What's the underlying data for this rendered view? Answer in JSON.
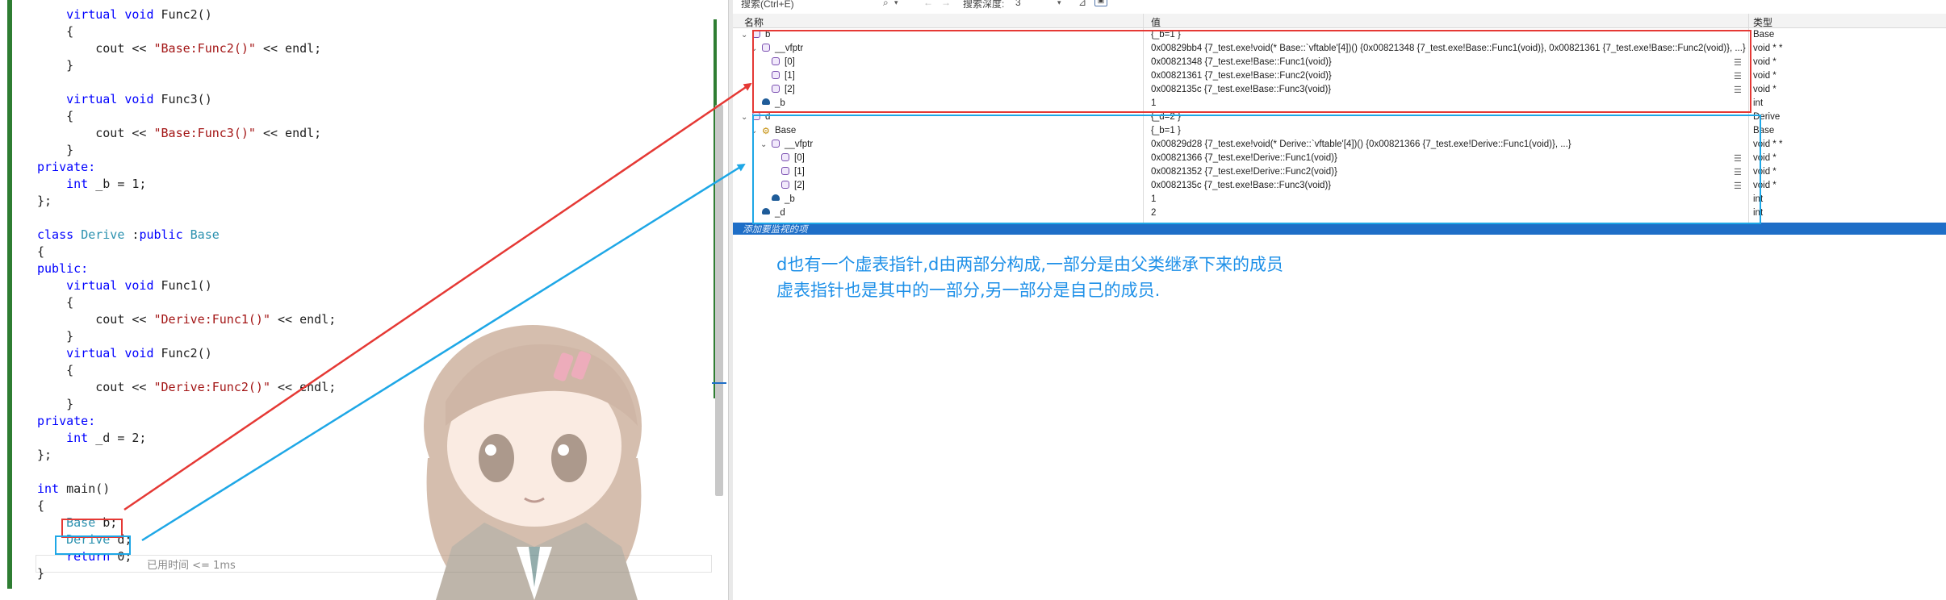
{
  "editor": {
    "lines": [
      [
        {
          "t": "    "
        },
        {
          "t": "virtual void",
          "c": "kw"
        },
        {
          "t": " Func2()"
        }
      ],
      [
        {
          "t": "    {"
        }
      ],
      [
        {
          "t": "        cout << "
        },
        {
          "t": "\"Base:Func2()\"",
          "c": "st"
        },
        {
          "t": " << endl;"
        }
      ],
      [
        {
          "t": "    }"
        }
      ],
      [
        {
          "t": ""
        }
      ],
      [
        {
          "t": "    "
        },
        {
          "t": "virtual void",
          "c": "kw"
        },
        {
          "t": " Func3()"
        }
      ],
      [
        {
          "t": "    {"
        }
      ],
      [
        {
          "t": "        cout << "
        },
        {
          "t": "\"Base:Func3()\"",
          "c": "st"
        },
        {
          "t": " << endl;"
        }
      ],
      [
        {
          "t": "    }"
        }
      ],
      [
        {
          "t": "private:",
          "c": "kw"
        }
      ],
      [
        {
          "t": "    "
        },
        {
          "t": "int",
          "c": "kw"
        },
        {
          "t": " _b = 1;"
        }
      ],
      [
        {
          "t": "};"
        }
      ],
      [
        {
          "t": ""
        }
      ],
      [
        {
          "t": "class",
          "c": "kw"
        },
        {
          "t": " "
        },
        {
          "t": "Derive",
          "c": "ty"
        },
        {
          "t": " :"
        },
        {
          "t": "public",
          "c": "kw"
        },
        {
          "t": " "
        },
        {
          "t": "Base",
          "c": "ty"
        }
      ],
      [
        {
          "t": "{"
        }
      ],
      [
        {
          "t": "public:",
          "c": "kw"
        }
      ],
      [
        {
          "t": "    "
        },
        {
          "t": "virtual void",
          "c": "kw"
        },
        {
          "t": " Func1()"
        }
      ],
      [
        {
          "t": "    {"
        }
      ],
      [
        {
          "t": "        cout << "
        },
        {
          "t": "\"Derive:Func1()\"",
          "c": "st"
        },
        {
          "t": " << endl;"
        }
      ],
      [
        {
          "t": "    }"
        }
      ],
      [
        {
          "t": "    "
        },
        {
          "t": "virtual void",
          "c": "kw"
        },
        {
          "t": " Func2()"
        }
      ],
      [
        {
          "t": "    {"
        }
      ],
      [
        {
          "t": "        cout << "
        },
        {
          "t": "\"Derive:Func2()\"",
          "c": "st"
        },
        {
          "t": " << endl;"
        }
      ],
      [
        {
          "t": "    }"
        }
      ],
      [
        {
          "t": "private:",
          "c": "kw"
        }
      ],
      [
        {
          "t": "    "
        },
        {
          "t": "int",
          "c": "kw"
        },
        {
          "t": " _d = 2;"
        }
      ],
      [
        {
          "t": "};"
        }
      ],
      [
        {
          "t": ""
        }
      ],
      [
        {
          "t": "int",
          "c": "kw"
        },
        {
          "t": " main()"
        }
      ],
      [
        {
          "t": "{"
        }
      ],
      [
        {
          "t": "    "
        },
        {
          "t": "Base",
          "c": "ty"
        },
        {
          "t": " b;"
        }
      ],
      [
        {
          "t": "    "
        },
        {
          "t": "Derive",
          "c": "ty"
        },
        {
          "t": " d;"
        }
      ],
      [
        {
          "t": "    "
        },
        {
          "t": "return",
          "c": "kw"
        },
        {
          "t": " 0;"
        }
      ],
      [
        {
          "t": "}"
        }
      ]
    ],
    "elapsed_hint": "已用时间 <= 1ms"
  },
  "watch": {
    "toolbar": {
      "search_placeholder": "搜索(Ctrl+E)",
      "depth_label": "搜索深度:",
      "depth_value": "3"
    },
    "columns": {
      "name": "名称",
      "value": "值",
      "type": "类型"
    },
    "rows": [
      {
        "chevron": "⌄",
        "icon": "obj",
        "indent": 0,
        "name": "b",
        "value": "{_b=1 }",
        "type": "Base"
      },
      {
        "chevron": "⌄",
        "icon": "obj",
        "indent": 1,
        "name": "__vfptr",
        "value": "0x00829bb4 {7_test.exe!void(* Base::`vftable'[4])() {0x00821348 {7_test.exe!Base::Func1(void)}, 0x00821361 {7_test.exe!Base::Func2(void)}, ...}",
        "type": "void * *"
      },
      {
        "chevron": "",
        "icon": "obj",
        "indent": 2,
        "name": "[0]",
        "value": "0x00821348 {7_test.exe!Base::Func1(void)}",
        "type": "void *",
        "view": true
      },
      {
        "chevron": "",
        "icon": "obj",
        "indent": 2,
        "name": "[1]",
        "value": "0x00821361 {7_test.exe!Base::Func2(void)}",
        "type": "void *",
        "view": true
      },
      {
        "chevron": "",
        "icon": "obj",
        "indent": 2,
        "name": "[2]",
        "value": "0x0082135c {7_test.exe!Base::Func3(void)}",
        "type": "void *",
        "view": true
      },
      {
        "chevron": "",
        "icon": "fld",
        "indent": 1,
        "name": "_b",
        "value": "1",
        "type": "int"
      },
      {
        "chevron": "⌄",
        "icon": "obj",
        "indent": 0,
        "name": "d",
        "value": "{_d=2 }",
        "type": "Derive"
      },
      {
        "chevron": "⌄",
        "icon": "base",
        "indent": 1,
        "name": "Base",
        "value": "{_b=1 }",
        "type": "Base"
      },
      {
        "chevron": "⌄",
        "icon": "obj",
        "indent": 2,
        "name": "__vfptr",
        "value": "0x00829d28 {7_test.exe!void(* Derive::`vftable'[4])() {0x00821366 {7_test.exe!Derive::Func1(void)}, ...}",
        "type": "void * *"
      },
      {
        "chevron": "",
        "icon": "obj",
        "indent": 3,
        "name": "[0]",
        "value": "0x00821366 {7_test.exe!Derive::Func1(void)}",
        "type": "void *",
        "view": true
      },
      {
        "chevron": "",
        "icon": "obj",
        "indent": 3,
        "name": "[1]",
        "value": "0x00821352 {7_test.exe!Derive::Func2(void)}",
        "type": "void *",
        "view": true
      },
      {
        "chevron": "",
        "icon": "obj",
        "indent": 3,
        "name": "[2]",
        "value": "0x0082135c {7_test.exe!Base::Func3(void)}",
        "type": "void *",
        "view": true
      },
      {
        "chevron": "",
        "icon": "fld",
        "indent": 2,
        "name": "_b",
        "value": "1",
        "type": "int"
      },
      {
        "chevron": "",
        "icon": "fld",
        "indent": 1,
        "name": "_d",
        "value": "2",
        "type": "int"
      }
    ],
    "add_watch_label": "添加要监视的项"
  },
  "annotation": {
    "line1": "d也有一个虚表指针,d由两部分构成,一部分是由父类继承下来的成员",
    "line2": "虚表指针也是其中的一部分,另一部分是自己的成员."
  },
  "colors": {
    "red_box": "#e53935",
    "blue_box": "#1ea7e6",
    "annotation_text": "#1e90e8",
    "selection": "#1e6ec7"
  },
  "icons": {
    "search": "search-icon",
    "back": "arrow-left-icon",
    "forward": "arrow-right-icon",
    "pin": "pin-icon",
    "view": "visualizer-icon"
  }
}
